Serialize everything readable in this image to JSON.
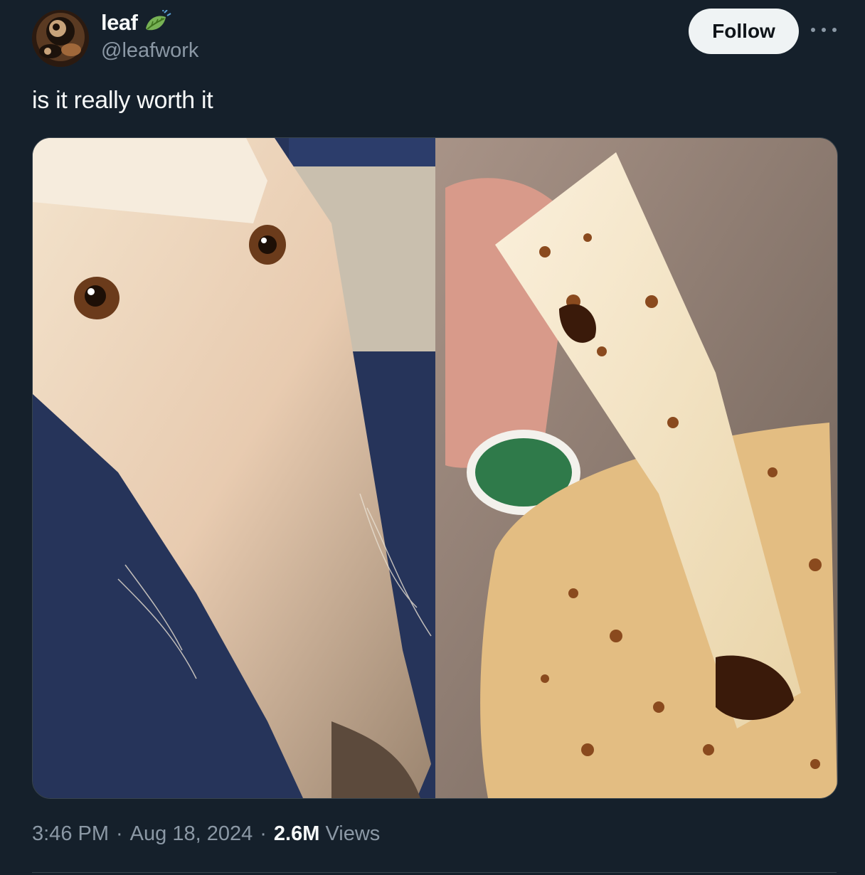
{
  "tweet": {
    "author": {
      "display_name": "leaf",
      "handle": "@leafwork",
      "badge_icon": "leaf-emoji-icon"
    },
    "follow_label": "Follow",
    "more_icon": "more-horizontal-icon",
    "text": "is it really worth it",
    "media": {
      "left_panel": "close-up of borzoi dog's long snout",
      "right_panel": "breadstick dipped in sauce next to garlic dip cup"
    },
    "meta": {
      "time": "3:46 PM",
      "separator1": "·",
      "date": "Aug 18, 2024",
      "separator2": "·",
      "views_count": "2.6M",
      "views_label": "Views"
    }
  },
  "colors": {
    "background": "#15202b",
    "primary_text": "#f7f9f9",
    "secondary_text": "#8b98a5",
    "follow_bg": "#eff3f4",
    "border": "#38444d"
  }
}
